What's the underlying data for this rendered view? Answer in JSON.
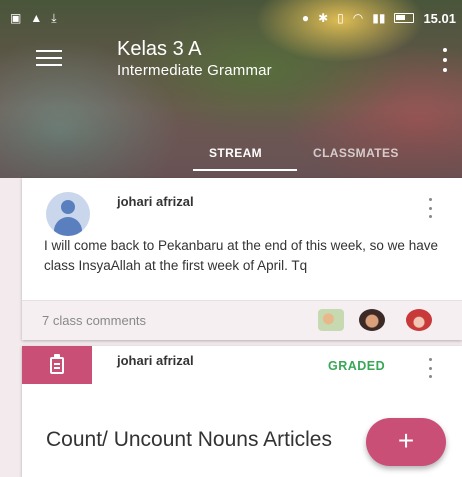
{
  "status_bar": {
    "time": "15.01",
    "icons": [
      "image-icon",
      "warning-icon",
      "download-icon",
      "location-icon",
      "bluetooth-icon",
      "vibrate-icon",
      "wifi-icon",
      "signal-icon",
      "battery-icon"
    ]
  },
  "app_bar": {
    "title": "Kelas 3 A",
    "subtitle": "Intermediate Grammar"
  },
  "tabs": [
    {
      "label": "STREAM",
      "active": true
    },
    {
      "label": "CLASSMATES",
      "active": false
    }
  ],
  "post": {
    "author": "johari afrizal",
    "text": "I will come back to Pekanbaru at the end of this week, so we have class InsyaAllah at the first week of April. Tq",
    "comments_label": "7 class comments"
  },
  "assignment": {
    "author": "johari afrizal",
    "status": "GRADED",
    "title": "Count/ Uncount  Nouns Articles"
  },
  "fab": {
    "label": "+"
  },
  "colors": {
    "accent": "#c94f76",
    "graded": "#3aa757"
  }
}
